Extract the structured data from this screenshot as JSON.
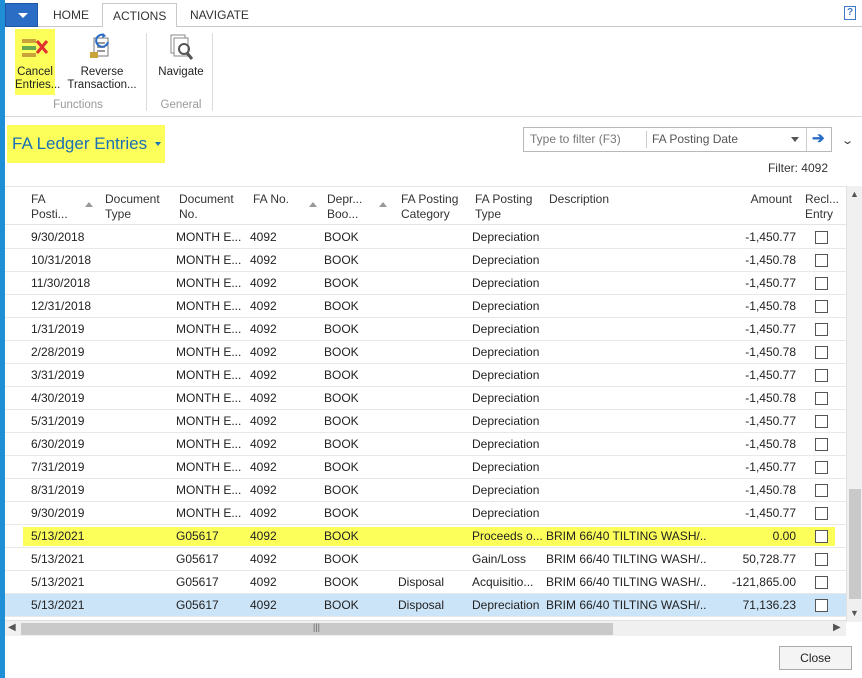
{
  "ribbon": {
    "tabs": [
      "HOME",
      "ACTIONS",
      "NAVIGATE"
    ],
    "help_label": "?",
    "buttons": {
      "cancel_entries": [
        "Cancel",
        "Entries..."
      ],
      "reverse_transaction": [
        "Reverse",
        "Transaction..."
      ],
      "navigate": [
        "Navigate"
      ]
    },
    "groups": {
      "functions": "Functions",
      "general": "General"
    }
  },
  "page": {
    "title": "FA Ledger Entries"
  },
  "filter": {
    "placeholder": "Type to filter (F3)",
    "field": "FA Posting Date",
    "status": "Filter: 4092"
  },
  "grid": {
    "columns": [
      [
        "FA",
        "Posti..."
      ],
      [
        "Document",
        "Type"
      ],
      [
        "Document",
        "No."
      ],
      [
        "FA No.",
        ""
      ],
      [
        "Depr...",
        "Boo..."
      ],
      [
        "FA Posting",
        "Category"
      ],
      [
        "FA Posting",
        "Type"
      ],
      [
        "Description",
        ""
      ],
      [
        "Amount",
        ""
      ],
      [
        "Recl...",
        "Entry"
      ]
    ],
    "rows": [
      [
        "9/30/2018",
        "",
        "MONTH E...",
        "4092",
        "BOOK",
        "",
        "Depreciation",
        "",
        "-1,450.77"
      ],
      [
        "10/31/2018",
        "",
        "MONTH E...",
        "4092",
        "BOOK",
        "",
        "Depreciation",
        "",
        "-1,450.78"
      ],
      [
        "11/30/2018",
        "",
        "MONTH E...",
        "4092",
        "BOOK",
        "",
        "Depreciation",
        "",
        "-1,450.77"
      ],
      [
        "12/31/2018",
        "",
        "MONTH E...",
        "4092",
        "BOOK",
        "",
        "Depreciation",
        "",
        "-1,450.78"
      ],
      [
        "1/31/2019",
        "",
        "MONTH E...",
        "4092",
        "BOOK",
        "",
        "Depreciation",
        "",
        "-1,450.77"
      ],
      [
        "2/28/2019",
        "",
        "MONTH E...",
        "4092",
        "BOOK",
        "",
        "Depreciation",
        "",
        "-1,450.78"
      ],
      [
        "3/31/2019",
        "",
        "MONTH E...",
        "4092",
        "BOOK",
        "",
        "Depreciation",
        "",
        "-1,450.77"
      ],
      [
        "4/30/2019",
        "",
        "MONTH E...",
        "4092",
        "BOOK",
        "",
        "Depreciation",
        "",
        "-1,450.78"
      ],
      [
        "5/31/2019",
        "",
        "MONTH E...",
        "4092",
        "BOOK",
        "",
        "Depreciation",
        "",
        "-1,450.77"
      ],
      [
        "6/30/2019",
        "",
        "MONTH E...",
        "4092",
        "BOOK",
        "",
        "Depreciation",
        "",
        "-1,450.78"
      ],
      [
        "7/31/2019",
        "",
        "MONTH E...",
        "4092",
        "BOOK",
        "",
        "Depreciation",
        "",
        "-1,450.77"
      ],
      [
        "8/31/2019",
        "",
        "MONTH E...",
        "4092",
        "BOOK",
        "",
        "Depreciation",
        "",
        "-1,450.78"
      ],
      [
        "9/30/2019",
        "",
        "MONTH E...",
        "4092",
        "BOOK",
        "",
        "Depreciation",
        "",
        "-1,450.77"
      ],
      [
        "5/13/2021",
        "",
        "G05617",
        "4092",
        "BOOK",
        "",
        "Proceeds o...",
        "BRIM 66/40 TILTING WASH/...",
        "0.00"
      ],
      [
        "5/13/2021",
        "",
        "G05617",
        "4092",
        "BOOK",
        "",
        "Gain/Loss",
        "BRIM 66/40 TILTING WASH/...",
        "50,728.77"
      ],
      [
        "5/13/2021",
        "",
        "G05617",
        "4092",
        "BOOK",
        "Disposal",
        "Acquisitio...",
        "BRIM 66/40 TILTING WASH/...",
        "-121,865.00"
      ],
      [
        "5/13/2021",
        "",
        "G05617",
        "4092",
        "BOOK",
        "Disposal",
        "Depreciation",
        "BRIM 66/40 TILTING WASH/...",
        "71,136.23"
      ]
    ],
    "highlighted_row": 13,
    "selected_row": 16
  },
  "footer": {
    "close_label": "Close"
  },
  "colors": {
    "accent": "#1e8ed6",
    "highlight": "#fcff5a",
    "title": "#1a6fb5",
    "selection": "#cce4f7"
  }
}
